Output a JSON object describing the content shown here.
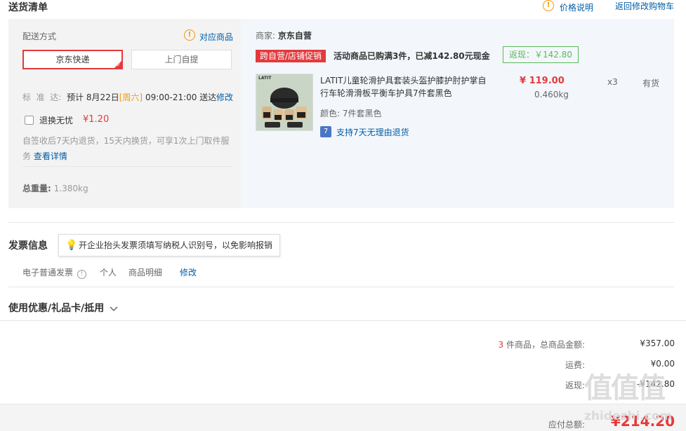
{
  "header": {
    "title": "送货清单",
    "price_explain": "价格说明",
    "back_cart": "返回修改购物车"
  },
  "shipping": {
    "label": "配送方式",
    "match_products": "对应商品",
    "option_jd": "京东快递",
    "option_pickup": "上门自提",
    "std_label": "标  准  达:",
    "std_prefix": "预计 8月22日",
    "std_weekday": "[周六]",
    "std_time": "09:00-21:00 送达",
    "modify": "修改",
    "return_worry": "退换无忧",
    "return_price": "¥1.20",
    "return_desc": "自签收后7天内退货，15天内换货，可享1次上门取件服务",
    "view_detail": "查看详情",
    "weight_label": "总重量:",
    "weight_value": "1.380kg"
  },
  "merchant": {
    "label": "商家:",
    "name": "京东自营",
    "promo_tag": "跨自营/店铺促销",
    "promo_text": "活动商品已购满3件，已减142.80元现金",
    "rebate": "返现：￥142.80"
  },
  "product": {
    "name": "LATIT儿童轮滑护具套装头盔护膝护肘护掌自行车轮滑滑板平衡车护具7件套黑色",
    "price": "¥ 119.00",
    "weight": "0.460kg",
    "qty": "x3",
    "stock": "有货",
    "color_label": "颜色:",
    "color_value": "7件套黑色",
    "return_badge": "7",
    "return_text": "支持7天无理由退货",
    "image_brand": "LATIT"
  },
  "invoice": {
    "title": "发票信息",
    "tip": "开企业抬头发票须填写纳税人识别号，以免影响报销",
    "type": "电子普通发票",
    "holder": "个人",
    "content": "商品明细",
    "modify": "修改"
  },
  "coupon": {
    "title": "使用优惠/礼品卡/抵用"
  },
  "summary": {
    "count": "3",
    "count_text": "件商品，总商品金额:",
    "total": "¥357.00",
    "freight_label": "运费:",
    "freight": "¥0.00",
    "rebate_label": "返现:",
    "rebate": "-¥142.80",
    "payable_label": "应付总额:",
    "payable": "¥214.20"
  },
  "watermark": {
    "text": "zhidezhi.com",
    "logo": "值值值"
  },
  "colors": {
    "accent_red": "#e4393c",
    "link_blue": "#005ea7",
    "warning_orange": "#f39800",
    "rebate_green": "#5cb85c"
  }
}
